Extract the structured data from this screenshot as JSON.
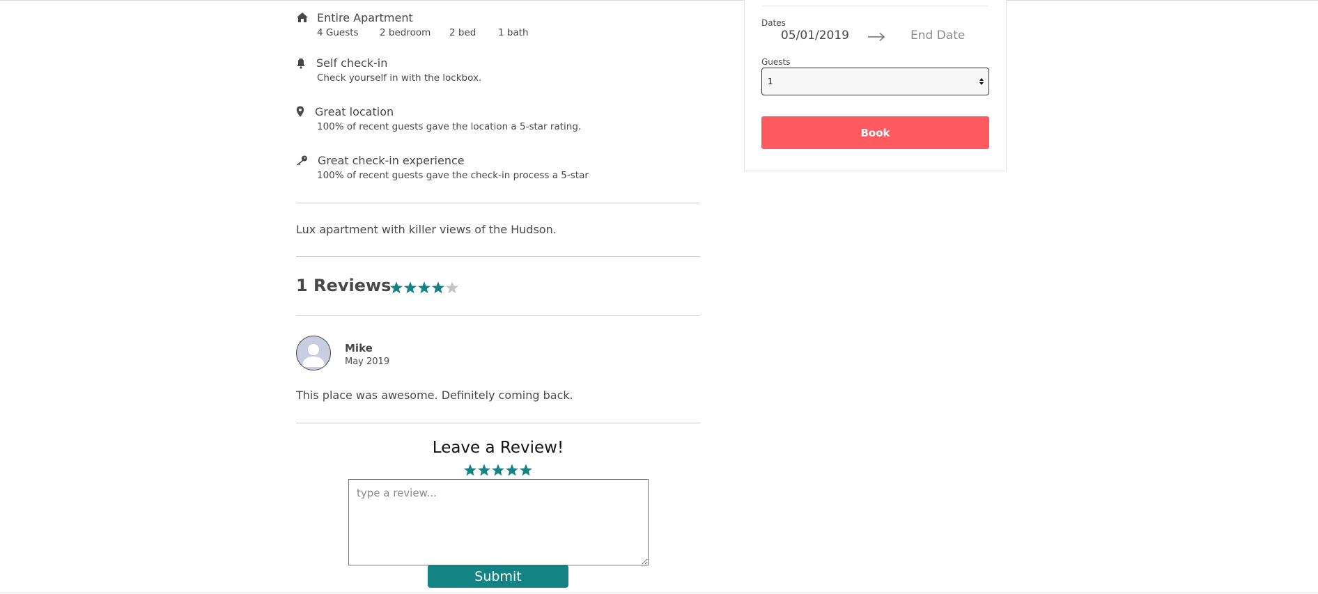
{
  "listing": {
    "amenities": [
      {
        "icon": "home-icon",
        "title": "Entire Apartment"
      },
      {
        "icon": "bell-icon",
        "title": "Self check-in",
        "subtitle": "Check yourself in with the lockbox."
      },
      {
        "icon": "map-pin-icon",
        "title": "Great location",
        "subtitle": "100% of recent guests gave the location a 5-star rating."
      },
      {
        "icon": "key-icon",
        "title": "Great check-in experience",
        "subtitle": "100% of recent guests gave the check-in process a 5-star"
      }
    ],
    "specs": [
      "4 Guests",
      "2 bedroom",
      "2 bed",
      "1 bath"
    ],
    "description": "Lux apartment with killer views of the Hudson."
  },
  "reviews": {
    "heading": "1 Reviews",
    "average_rating": 4,
    "max_rating": 5,
    "star_color": "#138384",
    "items": [
      {
        "name": "Mike",
        "date": "May 2019",
        "text": "This place was awesome. Definitely coming back."
      }
    ]
  },
  "leave_review": {
    "heading": "Leave a Review!",
    "rating": 5,
    "placeholder": "type a review...",
    "submit_label": "Submit",
    "button_color": "#138384"
  },
  "booking": {
    "dates_label": "Dates",
    "start_date": "05/01/2019",
    "end_date_placeholder": "End Date",
    "guests_label": "Guests",
    "guests_value": "1",
    "book_label": "Book",
    "book_color": "#ff5a5f"
  }
}
